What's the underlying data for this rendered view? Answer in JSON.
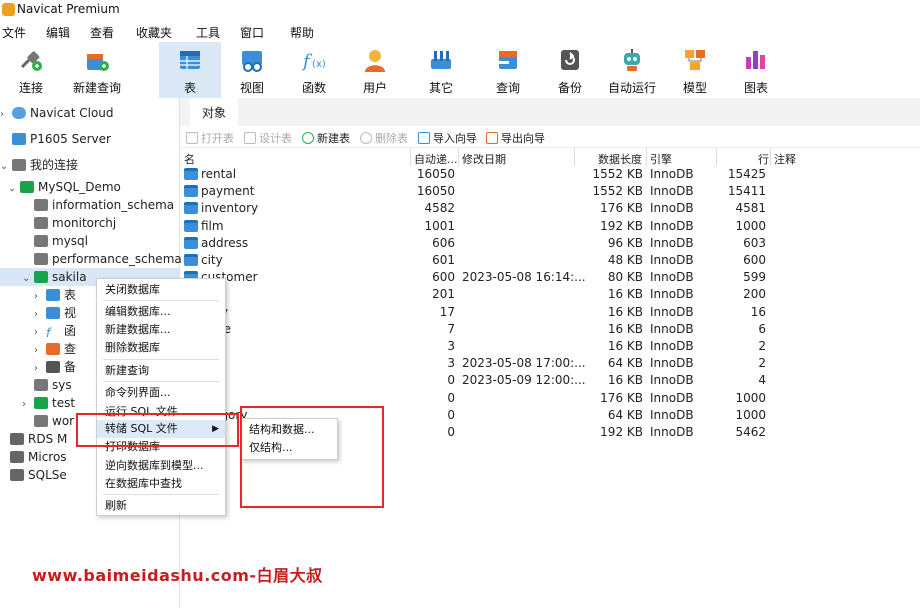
{
  "app": {
    "title": "Navicat Premium"
  },
  "menubar": [
    "文件",
    "编辑",
    "查看",
    "收藏夹",
    "工具",
    "窗口",
    "帮助"
  ],
  "toolbar": [
    {
      "label": "连接",
      "icon": "connection-icon"
    },
    {
      "label": "新建查询",
      "icon": "new-query-icon"
    },
    {
      "label": "表",
      "icon": "table-icon",
      "active": true
    },
    {
      "label": "视图",
      "icon": "view-icon"
    },
    {
      "label": "函数",
      "icon": "function-icon"
    },
    {
      "label": "用户",
      "icon": "user-icon"
    },
    {
      "label": "其它",
      "icon": "tools-icon"
    },
    {
      "label": "查询",
      "icon": "query-icon"
    },
    {
      "label": "备份",
      "icon": "backup-icon"
    },
    {
      "label": "自动运行",
      "icon": "robot-icon"
    },
    {
      "label": "模型",
      "icon": "model-icon"
    },
    {
      "label": "图表",
      "icon": "chart-icon"
    }
  ],
  "tree": {
    "navicat_cloud": "Navicat Cloud",
    "p1605": "P1605 Server",
    "my_connections": "我的连接",
    "mysql_demo": "MySQL_Demo",
    "databases": [
      "information_schema",
      "monitorchj",
      "mysql",
      "performance_schema"
    ],
    "sakila": "sakila",
    "sakila_children": [
      "表",
      "视",
      "函",
      "查",
      "备"
    ],
    "sys": "sys",
    "test": "test",
    "wor": "wor",
    "rds": "RDS M",
    "micros": "Micros",
    "sqlse": "SQLSe"
  },
  "tabs": {
    "objects": "对象"
  },
  "objtoolbar": {
    "open": "打开表",
    "design": "设计表",
    "new": "新建表",
    "delete": "删除表",
    "import": "导入向导",
    "export": "导出向导"
  },
  "grid": {
    "headers": [
      "名",
      "自动递...",
      "修改日期",
      "数据长度",
      "引擎",
      "行",
      "注释"
    ],
    "rows": [
      {
        "name": "rental",
        "auto": "16050",
        "date": "",
        "len": "1552 KB",
        "engine": "InnoDB",
        "rows": "15425"
      },
      {
        "name": "payment",
        "auto": "16050",
        "date": "",
        "len": "1552 KB",
        "engine": "InnoDB",
        "rows": "15411"
      },
      {
        "name": "inventory",
        "auto": "4582",
        "date": "",
        "len": "176 KB",
        "engine": "InnoDB",
        "rows": "4581"
      },
      {
        "name": "film",
        "auto": "1001",
        "date": "",
        "len": "192 KB",
        "engine": "InnoDB",
        "rows": "1000"
      },
      {
        "name": "address",
        "auto": "606",
        "date": "",
        "len": "96 KB",
        "engine": "InnoDB",
        "rows": "603"
      },
      {
        "name": "city",
        "auto": "601",
        "date": "",
        "len": "48 KB",
        "engine": "InnoDB",
        "rows": "600"
      },
      {
        "name": "customer",
        "auto": "600",
        "date": "2023-05-08 16:14:...",
        "len": "80 KB",
        "engine": "InnoDB",
        "rows": "599"
      },
      {
        "name": "",
        "auto": "201",
        "date": "",
        "len": "16 KB",
        "engine": "InnoDB",
        "rows": "200"
      },
      {
        "name": "gory",
        "auto": "17",
        "date": "",
        "len": "16 KB",
        "engine": "InnoDB",
        "rows": "16"
      },
      {
        "name": "uage",
        "auto": "7",
        "date": "",
        "len": "16 KB",
        "engine": "InnoDB",
        "rows": "6"
      },
      {
        "name": "",
        "auto": "3",
        "date": "",
        "len": "16 KB",
        "engine": "InnoDB",
        "rows": "2"
      },
      {
        "name": "",
        "auto": "3",
        "date": "2023-05-08 17:00:...",
        "len": "64 KB",
        "engine": "InnoDB",
        "rows": "2"
      },
      {
        "name": "",
        "auto": "0",
        "date": "2023-05-09 12:00:...",
        "len": "16 KB",
        "engine": "InnoDB",
        "rows": "4"
      },
      {
        "name": "text",
        "auto": "0",
        "date": "",
        "len": "176 KB",
        "engine": "InnoDB",
        "rows": "1000"
      },
      {
        "name": "ategory",
        "auto": "0",
        "date": "",
        "len": "64 KB",
        "engine": "InnoDB",
        "rows": "1000"
      },
      {
        "name": "",
        "auto": "0",
        "date": "",
        "len": "192 KB",
        "engine": "InnoDB",
        "rows": "5462"
      }
    ]
  },
  "contextmenu": {
    "items": [
      "关闭数据库",
      "编辑数据库...",
      "新建数据库...",
      "删除数据库",
      "新建查询",
      "命令列界面...",
      "运行 SQL 文件...",
      "转储 SQL 文件",
      "打印数据库",
      "逆向数据库到模型...",
      "在数据库中查找",
      "刷新"
    ],
    "submenu": [
      "结构和数据...",
      "仅结构..."
    ]
  },
  "watermark": "www.baimeidashu.com-白眉大叔",
  "colors": {
    "accent": "#3b8fd9",
    "highlight": "#e8262b",
    "active_tab": "#dbe9f7"
  }
}
